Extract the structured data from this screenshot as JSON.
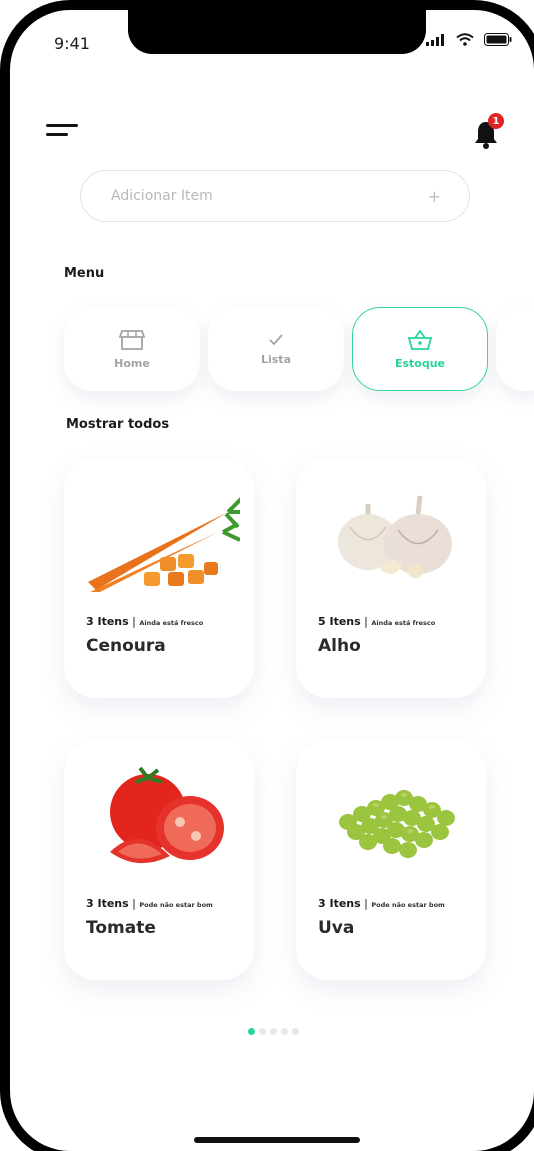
{
  "status_bar": {
    "time": "9:41"
  },
  "notifications": {
    "count": "1"
  },
  "search": {
    "placeholder": "Adicionar Item",
    "add_symbol": "+"
  },
  "menu_section": {
    "title": "Menu",
    "items": [
      {
        "label": "Home",
        "icon": "store-icon",
        "active": false
      },
      {
        "label": "Lista",
        "icon": "checkmark-icon",
        "active": false
      },
      {
        "label": "Estoque",
        "icon": "basket-icon",
        "active": true
      }
    ]
  },
  "products_section": {
    "title": "Mostrar todos",
    "items": [
      {
        "count": "3 Itens",
        "status": "Ainda está fresco",
        "name": "Cenoura",
        "image": "carrot-image"
      },
      {
        "count": "5 Itens",
        "status": "Ainda está fresco",
        "name": "Alho",
        "image": "garlic-image"
      },
      {
        "count": "3 Itens",
        "status": "Pode não estar bom",
        "name": "Tomate",
        "image": "tomato-image"
      },
      {
        "count": "3 Itens",
        "status": "Pode não estar bom",
        "name": "Uva",
        "image": "grapes-image"
      }
    ]
  },
  "pagination": {
    "pages": 5,
    "current": 1
  },
  "colors": {
    "accent": "#27d39b",
    "badge": "#e02424",
    "text": "#1b1b1b"
  }
}
